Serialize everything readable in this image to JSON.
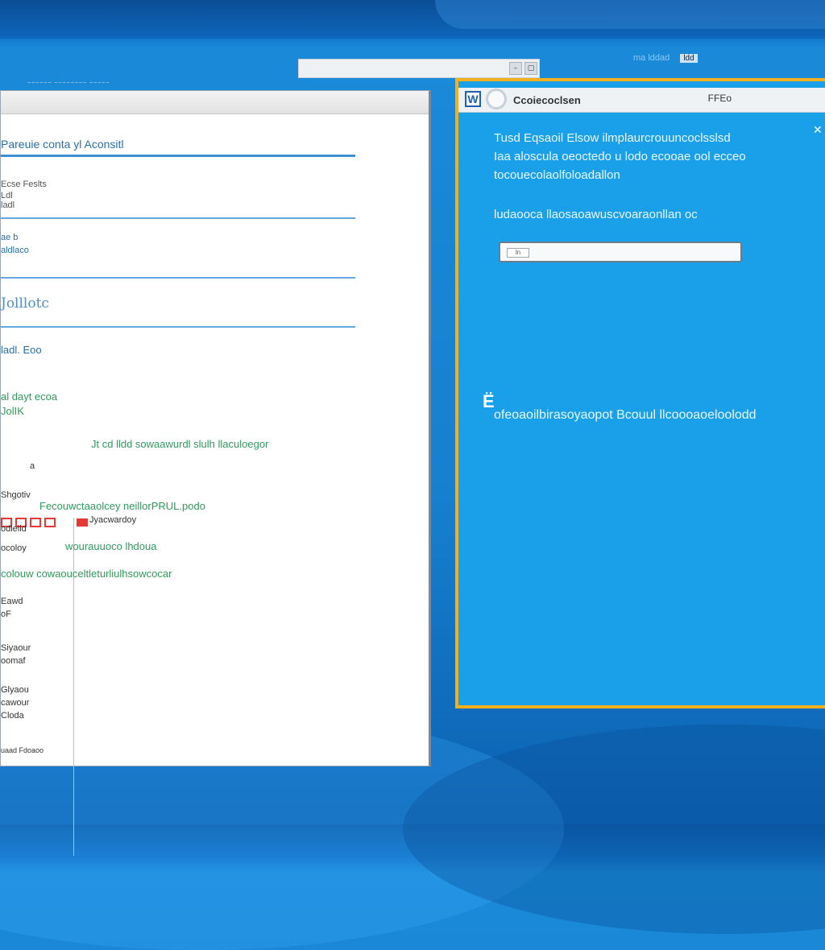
{
  "desktop": {
    "top_right_text": "ma lddad",
    "top_right_tag": "ldd",
    "tiny_link": "~~~~~~ ~~~~~~~~ ~~~~~"
  },
  "strip": {
    "btn1": "–",
    "btn2": "▢"
  },
  "left_window": {
    "header": "Pareuie conta yl Aconsitl",
    "field1_label": "Ecse  Feslts",
    "field1_value": "Ldl",
    "field1_value2": "ladl",
    "field2_label": "ae b",
    "field2_value": "aldlaco",
    "section_title": "Jolllotc",
    "sub_label": "ladl. Eoo",
    "list_title": "al dayt ecoa",
    "list_sub": "JolIK",
    "tab_text": "Jyacwardoy",
    "row1": "Jt cd lldd sowaawurdl slulh llaculoegor",
    "row2": "a",
    "row3_label": "Shgotiv",
    "row3": "Fecouwctaaolcey neillorPRUL.podo",
    "row4_label": "odlelld",
    "row5_label": "ocoloy",
    "row5": "wourauuoco lhdoua",
    "row6": "colouw   cowaouceltleturliulhsowcocar",
    "row7_label": "Eawd",
    "row8_label": "oF",
    "row9_label": "Siyaour",
    "row10_label": "oomaf",
    "row11_label": "Glyaou",
    "row12_label": "cawour",
    "row13_label": "Cloda",
    "footer": "uaad Fdoaoo"
  },
  "right_window": {
    "app_icon_letter": "W",
    "title": "Ccoiecoclsen",
    "title_button": "FFEo",
    "close": "✕",
    "intro_line1": "Tusd Eqsaoil  Elsow ilmplaurcrouuncoclsslsd",
    "intro_line2": "Iaa aloscula  oeoctedo u lodo ecooae ool ecceo",
    "intro_line3": "tocouecolaolfoloadallon",
    "prompt": "ludaooca llaosaoawuscvoaraonllan oc",
    "input_mini": "ln",
    "link_icon_char": "Ë",
    "link_text": "ofeoaoilbirasoyaopot Bcouul llcoooaoeloolodd"
  }
}
